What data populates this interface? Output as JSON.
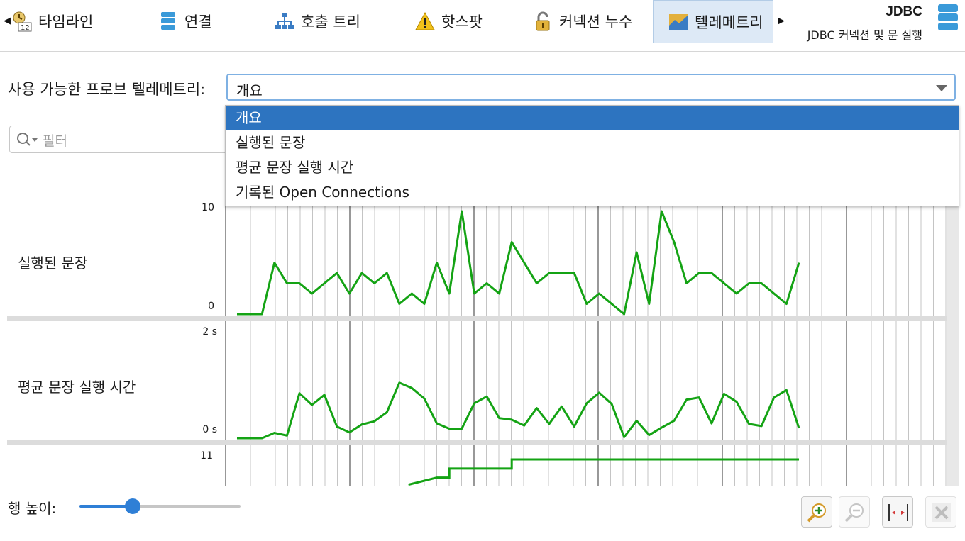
{
  "tabs": [
    {
      "label": "타임라인",
      "icon": "timeline-icon",
      "active": false
    },
    {
      "label": "연결",
      "icon": "connection-icon",
      "active": false
    },
    {
      "label": "호출 트리",
      "icon": "call-tree-icon",
      "active": false
    },
    {
      "label": "핫스팟",
      "icon": "hotspot-warning-icon",
      "active": false
    },
    {
      "label": "커넥션 누수",
      "icon": "padlock-icon",
      "active": false
    },
    {
      "label": "텔레메트리",
      "icon": "telemetry-icon",
      "active": true
    }
  ],
  "probe": {
    "title": "JDBC",
    "subtitle": "JDBC 커넥션 및 문 실행",
    "icon": "database-icon"
  },
  "telemetry_select": {
    "label": "사용 가능한 프로브 텔레메트리:",
    "value": "개요"
  },
  "dropdown_options": [
    "개요",
    "실행된 문장",
    "평균 문장 실행 시간",
    "기록된 Open Connections"
  ],
  "filter": {
    "placeholder": "필터"
  },
  "tracks": [
    {
      "label": "실행된 문장",
      "top_tick": "10",
      "bottom_tick": "0"
    },
    {
      "label": "평균 문장 실행 시간",
      "top_tick": "2 s",
      "bottom_tick": "0 s"
    },
    {
      "label": "",
      "top_tick": "11",
      "bottom_tick": ""
    }
  ],
  "row_height": {
    "label": "행 높이:",
    "value_fraction": 0.33
  },
  "colors": {
    "series": "#14a314",
    "accent": "#2d74c0"
  },
  "chart_data": [
    {
      "type": "line",
      "title": "실행된 문장",
      "ylim": [
        0,
        10
      ],
      "values": [
        0,
        0,
        0,
        5,
        3,
        3,
        2,
        3,
        4,
        2,
        4,
        3,
        4,
        1,
        2,
        1,
        5,
        2,
        10,
        2,
        3,
        2,
        7,
        5,
        3,
        4,
        4,
        4,
        1,
        2,
        1,
        0,
        6,
        1,
        10,
        7,
        3,
        4,
        4,
        3,
        2,
        3,
        3,
        2,
        1,
        5
      ]
    },
    {
      "type": "line",
      "title": "평균 문장 실행 시간",
      "unit": "s",
      "ylim": [
        0,
        2
      ],
      "values": [
        0,
        0,
        0,
        0.1,
        0.05,
        0.85,
        0.63,
        0.82,
        0.22,
        0.11,
        0.26,
        0.32,
        0.49,
        1.05,
        0.95,
        0.75,
        0.28,
        0.18,
        0.18,
        0.66,
        0.79,
        0.38,
        0.35,
        0.24,
        0.57,
        0.27,
        0.6,
        0.22,
        0.66,
        0.86,
        0.65,
        0.02,
        0.33,
        0.06,
        0.2,
        0.33,
        0.73,
        0.77,
        0.28,
        0.84,
        0.69,
        0.27,
        0.23,
        0.77,
        0.91,
        0.19
      ]
    },
    {
      "type": "line",
      "title": "기록된 Open Connections",
      "ylim": [
        0,
        11
      ],
      "values": [
        null,
        null,
        null,
        null,
        null,
        null,
        null,
        null,
        null,
        null,
        null,
        null,
        null,
        null,
        null,
        null,
        9,
        10,
        10,
        10,
        10,
        10,
        11,
        11,
        11,
        11,
        11,
        11,
        11,
        11,
        11,
        11,
        11,
        11,
        11,
        11,
        11,
        11,
        11,
        11,
        11,
        11,
        11,
        11,
        11,
        11
      ]
    }
  ]
}
